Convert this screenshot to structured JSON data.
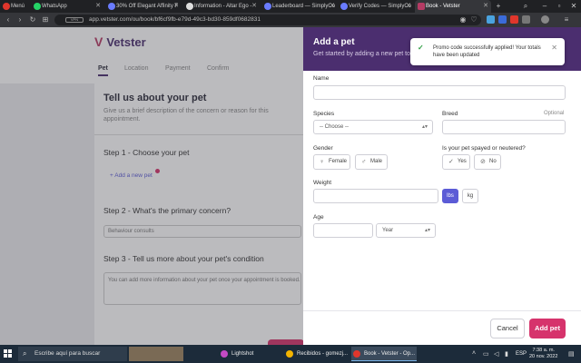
{
  "browser": {
    "tabs": [
      {
        "label": "Menú",
        "icon": "opera-icon"
      },
      {
        "label": "WhatsApp",
        "icon": "whatsapp-icon"
      },
      {
        "label": "30% Off Elegant Affinity F",
        "icon": "globe-icon"
      },
      {
        "label": "Information - Altar Ego - ",
        "icon": "globe-icon"
      },
      {
        "label": "Leaderboard — SimplyCo",
        "icon": "globe-icon"
      },
      {
        "label": "Verify Codes — SimplyCo",
        "icon": "globe-icon"
      },
      {
        "label": "Book - Vetster",
        "icon": "vetster-icon"
      }
    ],
    "new_tab": "+",
    "url": "app.vetster.com/ou/book/bf6cf9fb-e79d-49c3-bd30-859df0682831",
    "vpn_label": "VPN"
  },
  "background_page": {
    "logo": "Vetster",
    "steps": [
      "Pet",
      "Location",
      "Payment",
      "Confirm"
    ],
    "heading": "Tell us about your pet",
    "subheading": "Give us a brief description of the concern or reason for this appointment.",
    "step1_title": "Step 1 - Choose your pet",
    "add_new_pet": "+ Add a new pet",
    "step2_title": "Step 2 - What's the primary concern?",
    "step2_value": "Behaviour consults",
    "step3_title": "Step 3 - Tell us more about your pet's condition",
    "step3_placeholder": "You can add more information about your pet once your appointment is booked."
  },
  "panel": {
    "title": "Add a pet",
    "subtitle": "Get started by adding a new pet to",
    "name_label": "Name",
    "species_label": "Species",
    "species_value": "-- Choose --",
    "breed_label": "Breed",
    "breed_optional": "Optional",
    "gender_label": "Gender",
    "gender_options": [
      "Female",
      "Male"
    ],
    "spayed_label": "Is your pet spayed or neutered?",
    "spayed_options": [
      "Yes",
      "No"
    ],
    "weight_label": "Weight",
    "weight_units": [
      "lbs",
      "kg"
    ],
    "weight_unit_selected": "lbs",
    "age_label": "Age",
    "age_unit_value": "Year",
    "cancel_label": "Cancel",
    "add_label": "Add pet"
  },
  "toast": {
    "message": "Promo code successfully applied! Your totals have been updated",
    "status_color": "#2f9e44"
  },
  "taskbar": {
    "search_placeholder": "Escribe aquí para buscar",
    "apps": [
      {
        "label": "Lightshot",
        "icon": "lightshot-icon"
      },
      {
        "label": "Recibidos - gomezj...",
        "icon": "chrome-icon"
      },
      {
        "label": "Book - Vetster - Op...",
        "icon": "opera-icon"
      }
    ],
    "language": "ESP",
    "time": "7:38 a. m.",
    "date": "20 nov. 2022"
  },
  "colors": {
    "brand": "#4b2e6f",
    "accent": "#d6336c",
    "unit_selected": "#5b5bd6"
  }
}
